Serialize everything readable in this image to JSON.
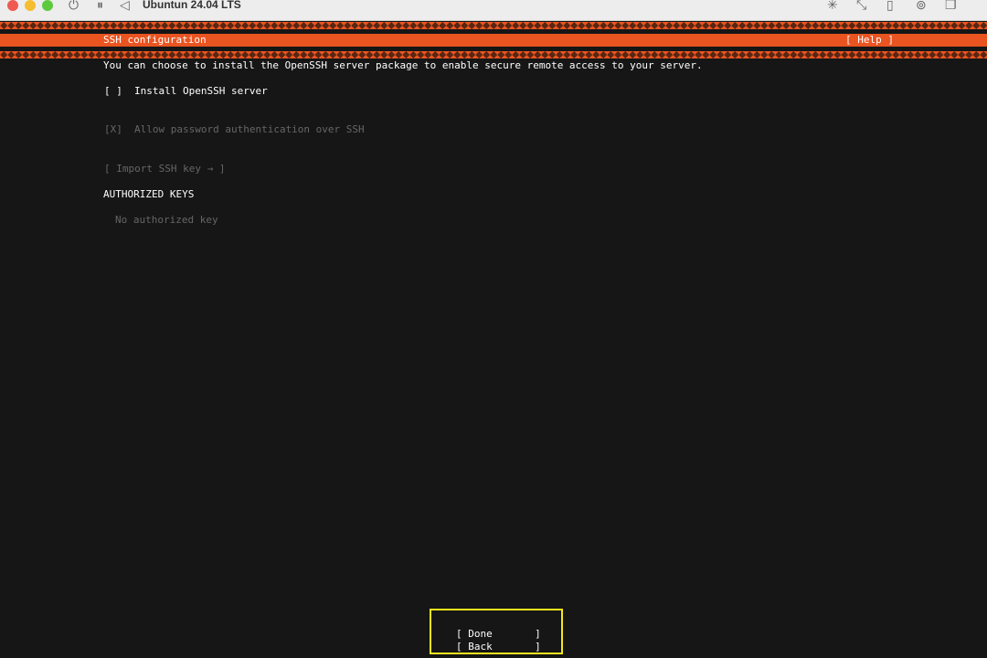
{
  "window": {
    "title": "Ubuntun 24.04 LTS",
    "icons": [
      "power-icon",
      "pause-icon",
      "back-icon",
      "brightness-icon",
      "resize-icon",
      "usb-icon",
      "network-icon",
      "window-icon"
    ]
  },
  "header": {
    "title": "SSH configuration",
    "help": "[ Help ]"
  },
  "main": {
    "description": "You can choose to install the OpenSSH server package to enable secure remote access to your server.",
    "install_checkbox": "[ ]",
    "install_label": "Install OpenSSH server",
    "password_checkbox": "[X]",
    "password_label": "Allow password authentication over SSH",
    "import_button": "[ Import SSH key → ]",
    "authorized_heading": "AUTHORIZED KEYS",
    "no_keys": "No authorized key"
  },
  "footer": {
    "done": "[ Done       ]",
    "back": "[ Back       ]"
  },
  "colors": {
    "accent": "#e95420",
    "background": "#161616",
    "highlight": "#f5e71a"
  }
}
